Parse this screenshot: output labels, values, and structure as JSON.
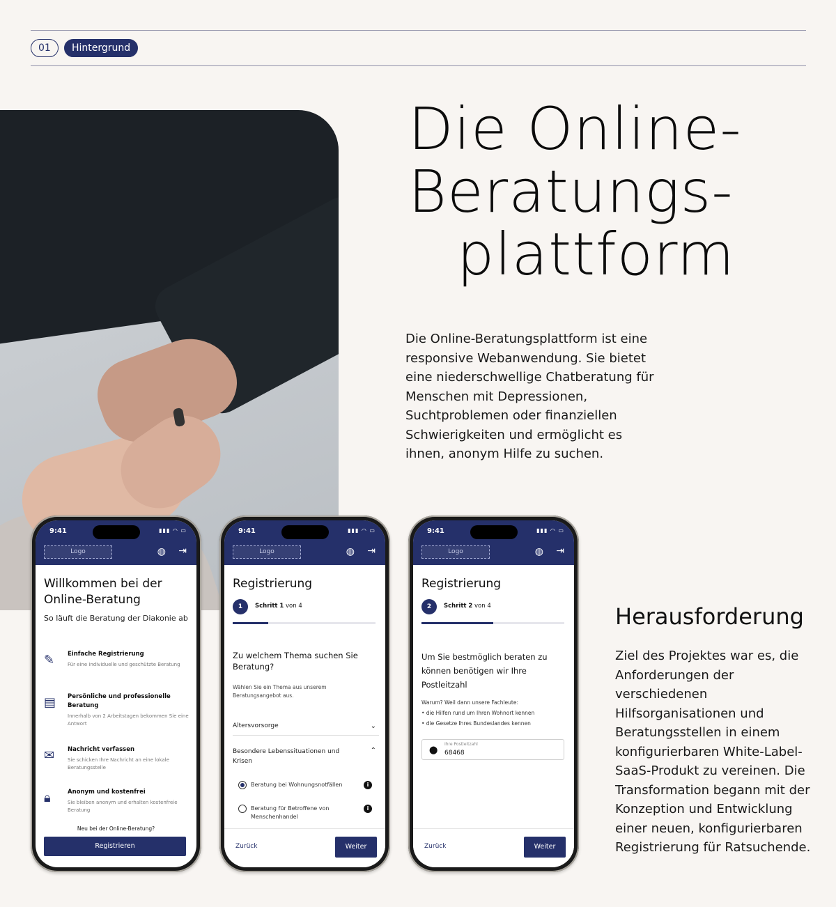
{
  "header": {
    "number": "01",
    "tag": "Hintergrund"
  },
  "title": {
    "line1": "Die Online-",
    "line2": "Beratungs-",
    "line3": "plattform"
  },
  "intro": "Die Online-Beratungsplattform ist eine responsive Webanwendung. Sie bietet eine niederschwellige Chatberatung für Menschen mit Depressionen, Suchtproblemen oder finanziellen Schwierigkeiten und ermöglicht es ihnen, anonym Hilfe zu suchen.",
  "challenge": {
    "heading": "Herausforderung",
    "text": "Ziel des Projektes war es, die Anforderungen der verschiedenen Hilfsorganisationen und Beratungsstellen in einem konfigurierbaren White-Label-SaaS-Produkt zu vereinen. Die Transformation begann mit der Konzeption und Entwicklung einer neuen, konfigurierbaren Registrierung für Ratsuchende."
  },
  "phone_common": {
    "time": "9:41",
    "logo": "Logo",
    "back": "Zurück",
    "next": "Weiter"
  },
  "phone1": {
    "title": "Willkommen bei der Online-Beratung",
    "subtitle": "So läuft die Beratung der Diakonie ab",
    "features": [
      {
        "icon": "pencil-icon",
        "title": "Einfache Registrierung",
        "desc": "Für eine individuelle und geschützte Beratung"
      },
      {
        "icon": "chat-icon",
        "title": "Persönliche und professionelle Beratung",
        "desc": "Innerhalb von 2 Arbeitstagen bekommen Sie eine Antwort"
      },
      {
        "icon": "mail-icon",
        "title": "Nachricht verfassen",
        "desc": "Sie schicken Ihre Nachricht an eine lokale Beratungsstelle"
      },
      {
        "icon": "lock-icon",
        "title": "Anonym und kostenfrei",
        "desc": "Sie bleiben anonym und erhalten kostenfreie Beratung"
      }
    ],
    "new_here": "Neu bei der Online-Beratung?",
    "register_button": "Registrieren"
  },
  "phone2": {
    "title": "Registrierung",
    "step_num": "1",
    "step_bold": "Schritt 1",
    "step_rest": " von 4",
    "progress": 0.25,
    "question": "Zu welchem Thema suchen Sie Beratung?",
    "question_desc": "Wählen Sie ein Thema aus unserem Beratungsangebot aus.",
    "topic1": "Altersvorsorge",
    "topic2": "Besondere Lebenssituationen und Krisen",
    "option1": "Beratung bei Wohnungsnotfällen",
    "option2": "Beratung für Betroffene von Menschenhandel",
    "selected_option": 1
  },
  "phone3": {
    "title": "Registrierung",
    "step_num": "2",
    "step_bold": "Schritt 2",
    "step_rest": " von 4",
    "progress": 0.5,
    "question": "Um Sie bestmöglich beraten zu können benötigen wir Ihre Postleitzahl",
    "why": "Warum? Weil dann unsere Fachleute:",
    "bullet1": "• die Hilfen rund um Ihren Wohnort kennen",
    "bullet2": "• die Gesetze Ihres Bundeslandes kennen",
    "field_label": "Ihre Postleitzahl",
    "field_value": "68468"
  },
  "colors": {
    "accent": "#25306a",
    "background": "#f8f5f2"
  }
}
